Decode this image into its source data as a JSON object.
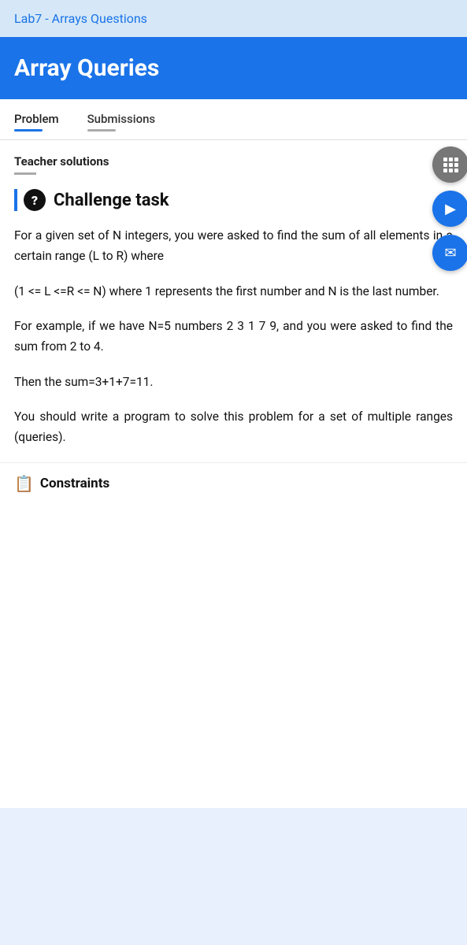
{
  "topbar": {
    "label": "Lab7 - Arrays Questions"
  },
  "header": {
    "title": "Array Queries"
  },
  "tabs": [
    {
      "label": "Problem",
      "active": true
    },
    {
      "label": "Submissions",
      "active": false
    }
  ],
  "teacherSolutions": {
    "label": "Teacher solutions"
  },
  "challenge": {
    "title": "Challenge task",
    "icon": "?"
  },
  "problemText": {
    "paragraph1": "For a given set of N integers, you were asked to find the sum of all elements in a certain range (L to R) where",
    "paragraph2": "(1 <= L <=R <= N) where 1 represents the first number and N is the last number.",
    "paragraph3": "For example, if we have N=5 numbers 2 3 1 7 9, and you were asked to find the sum from 2 to 4.",
    "paragraph4": "Then the sum=3+1+7=11.",
    "paragraph5": "You should write a program to solve this problem for a set of multiple ranges (queries)."
  },
  "constraintsPreview": {
    "icon": "📋",
    "label": "Constraints"
  },
  "floatingButtons": [
    {
      "name": "grid-toggle",
      "type": "gray",
      "icon": "grid"
    },
    {
      "name": "play",
      "type": "blue",
      "icon": "play"
    },
    {
      "name": "send",
      "type": "blue",
      "icon": "send"
    }
  ],
  "detection": {
    "of_text": "of"
  }
}
